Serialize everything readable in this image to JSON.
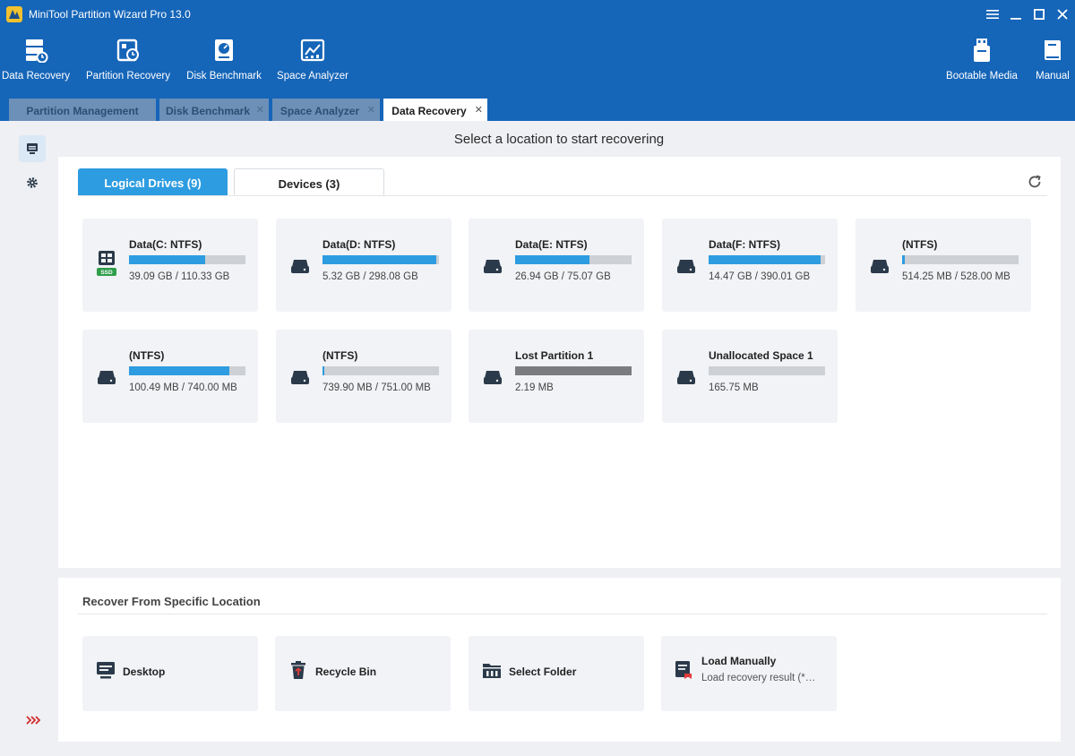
{
  "window": {
    "title": "MiniTool Partition Wizard Pro 13.0"
  },
  "toolbar": {
    "items": [
      {
        "label": "Data Recovery",
        "icon": "data-recovery-icon"
      },
      {
        "label": "Partition Recovery",
        "icon": "partition-recovery-icon"
      },
      {
        "label": "Disk Benchmark",
        "icon": "disk-benchmark-icon"
      },
      {
        "label": "Space Analyzer",
        "icon": "space-analyzer-icon"
      },
      {
        "label": "Bootable Media",
        "icon": "bootable-media-icon"
      },
      {
        "label": "Manual",
        "icon": "manual-icon"
      }
    ]
  },
  "tabs": [
    {
      "label": "Partition Management",
      "active": false
    },
    {
      "label": "Disk Benchmark",
      "active": false
    },
    {
      "label": "Space Analyzer",
      "active": false
    },
    {
      "label": "Data Recovery",
      "active": true
    }
  ],
  "page": {
    "title": "Select a location to start recovering"
  },
  "drive_tabs": [
    {
      "label": "Logical Drives (9)",
      "active": true
    },
    {
      "label": "Devices (3)",
      "active": false
    }
  ],
  "drives": [
    {
      "name": "Data(C: NTFS)",
      "size": "39.09 GB / 110.33 GB",
      "used": 0.65,
      "badge": "SSD"
    },
    {
      "name": "Data(D: NTFS)",
      "size": "5.32 GB / 298.08 GB",
      "used": 0.98
    },
    {
      "name": "Data(E: NTFS)",
      "size": "26.94 GB / 75.07 GB",
      "used": 0.64
    },
    {
      "name": "Data(F: NTFS)",
      "size": "14.47 GB / 390.01 GB",
      "used": 0.96
    },
    {
      "name": "(NTFS)",
      "size": "514.25 MB / 528.00 MB",
      "used": 0.02
    },
    {
      "name": "(NTFS)",
      "size": "100.49 MB / 740.00 MB",
      "used": 0.86
    },
    {
      "name": "(NTFS)",
      "size": "739.90 MB / 751.00 MB",
      "used": 0.015
    },
    {
      "name": "Lost Partition 1",
      "size": "2.19 MB",
      "used": 1.0,
      "bar": "grey"
    },
    {
      "name": "Unallocated Space 1",
      "size": "165.75 MB",
      "used": 0.0
    }
  ],
  "specific": {
    "title": "Recover From Specific Location",
    "items": [
      {
        "label": "Desktop",
        "icon": "desktop-icon"
      },
      {
        "label": "Recycle Bin",
        "icon": "recycle-bin-icon"
      },
      {
        "label": "Select Folder",
        "icon": "folder-icon"
      },
      {
        "label": "Load Manually",
        "sub": "Load recovery result (*…",
        "icon": "load-manually-icon"
      }
    ]
  },
  "colors": {
    "brand": "#1565b8",
    "accent": "#2d9ce0",
    "panel": "#f1f3f6"
  }
}
